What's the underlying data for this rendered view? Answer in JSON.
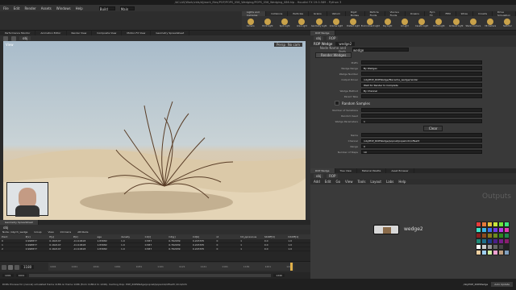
{
  "window": {
    "title": "/ACLAS/Work/vids/dj/work_files/POP/POPS_056_Wedging/POPS_056_Wedging_086.hip - Houdini FX 19.0.589 - Python 3"
  },
  "menubar": {
    "items": [
      "File",
      "Edit",
      "Render",
      "Assets",
      "Windows",
      "Help"
    ],
    "desktop": "Build",
    "context": "Main"
  },
  "shelf_tabs": [
    "Lights and Cameras",
    "Collisions",
    "Particles",
    "Grains",
    "Vellum",
    "Rigid Bodies",
    "Particle Fluids",
    "Viscous Fluids",
    "Oceans",
    "Pyro FX",
    "FEM",
    "Wires",
    "Crowds",
    "Drive Simulation"
  ],
  "shelf_tools": [
    "Camera",
    "Point Light",
    "Spot Light",
    "Area Light",
    "Geometry Light",
    "Volume Light",
    "Distant Light",
    "Environment Light",
    "Sky Light",
    "GI Light",
    "Caustic Light",
    "Portal Light",
    "Ambient Light",
    "Stereo Camera",
    "VR Camera",
    "Switcher"
  ],
  "pane_tabs_left": [
    "Performance Monitor",
    "Animation Editor",
    "Render View",
    "Composite View",
    "Motion FX View",
    "Geometry Spreadsheet"
  ],
  "pane_tabs_right": [
    "ROP Wedge",
    "Tree View",
    "Material Palette",
    "Asset Browser"
  ],
  "viewport": {
    "path": "obj",
    "label": "View",
    "camera": "Persp",
    "view_mode": "No cam"
  },
  "param_panel": {
    "path": "obj",
    "node_path": "ROP",
    "node_type": "ROP Wedge",
    "node_name": "wedge2",
    "row1_label": "Node Name and Path",
    "row1_value": "wedge",
    "tab": "Render Wedges",
    "fields": [
      {
        "label": "Prefix",
        "value": ""
      },
      {
        "label": "Wedge Range",
        "value": "By Wedges"
      },
      {
        "label": "Wedge Number",
        "value": ""
      },
      {
        "label": "Output Driver",
        "value": "/obj/POP_ROPWedge/filecache_wedge/render"
      },
      {
        "label": "",
        "value": "Wait for Render to Complete"
      },
      {
        "label": "Wedge Method",
        "value": "By Channel"
      },
      {
        "label": "Parent Take",
        "value": ""
      }
    ],
    "random_label": "Random Samples",
    "fields2": [
      {
        "label": "Number of Variations",
        "value": ""
      },
      {
        "label": "Random Seed",
        "value": ""
      },
      {
        "label": "Wedge Parameters",
        "value": "1"
      }
    ],
    "clear_btn": "Clear",
    "fields3": [
      {
        "label": "Name",
        "value": ""
      },
      {
        "label": "Channel",
        "value": "/obj/POP_ROPWedge/popnet/popwind1/offset3"
      },
      {
        "label": "Range",
        "value": "0"
      },
      {
        "label": "Number of Steps",
        "value": "10"
      }
    ]
  },
  "network": {
    "path": "obj",
    "node_path": "ROP",
    "menu": [
      "Add",
      "Edit",
      "Go",
      "View",
      "Tools",
      "Layout",
      "Labs",
      "Help"
    ],
    "outputs_label": "Outputs",
    "node_label": "wedge2"
  },
  "spreadsheet": {
    "path": "obj",
    "node": "Node: /obj/ch_wedge",
    "group": "Group",
    "view": "View",
    "intrinsics": "Intrinsics",
    "attribute": "Attribute",
    "columns": [
      "Point",
      "P[x]",
      "P[y]",
      "P[z]",
      "age",
      "density",
      "Cd[r]",
      "Cd[g]",
      "Cd[b]",
      "id",
      "hit_pprevious",
      "hitdiff[0]",
      "hitdiff[1]"
    ],
    "rows": [
      [
        "0",
        "0.998877",
        "0.162147",
        "-0.110618",
        "1.83082",
        "1.0",
        "0.587",
        "0.762939",
        "0.223335",
        "0",
        "1",
        "0.0",
        "1.0"
      ],
      [
        "1",
        "0.998877",
        "0.162147",
        "-0.110618",
        "1.83082",
        "1.0",
        "0.587",
        "0.762939",
        "0.223335",
        "0",
        "1",
        "0.0",
        "1.0"
      ],
      [
        "2",
        "0.998877",
        "0.162147",
        "-0.110618",
        "1.83082",
        "1.0",
        "0.587",
        "0.762939",
        "0.223335",
        "0",
        "1",
        "0.0",
        "1.0"
      ]
    ]
  },
  "timeline": {
    "frame": "1180",
    "start": "1001",
    "end": "1001",
    "range_end": "1240",
    "ticks": [
      "1001",
      "1021",
      "1041",
      "1061",
      "1081",
      "1101",
      "1121",
      "1141",
      "1161",
      "1181",
      "1201",
      "1221"
    ]
  },
  "status": {
    "text": "DOPs Process for (cancel) simulated frame 1186 on frame 1186 (from 1186.0 to 1246). Caching Dop: POP_ROPWedge/popnet/popwind/offset3 /click/info",
    "right": "/obj/POP_ROPWedge",
    "auto": "Auto Update"
  },
  "swatches": [
    "#e63c3c",
    "#e67a3c",
    "#e6c03c",
    "#c8e63c",
    "#6ee63c",
    "#3ce67a",
    "#3ce6c8",
    "#3cb4e6",
    "#3c6ee6",
    "#6e3ce6",
    "#b43ce6",
    "#e63cb4",
    "#8a1e1e",
    "#8a4a1e",
    "#8a781e",
    "#6e8a1e",
    "#2e8a1e",
    "#1e8a4a",
    "#1e8a78",
    "#1e6e8a",
    "#1e3a8a",
    "#4a1e8a",
    "#781e8a",
    "#8a1e6e",
    "#ffffff",
    "#cccccc",
    "#999999",
    "#666666",
    "#444444",
    "#222222",
    "#f0d0a0",
    "#a0d0f0",
    "#d0f0a0",
    "#f0a0d0",
    "#c0a080",
    "#80a0c0"
  ]
}
